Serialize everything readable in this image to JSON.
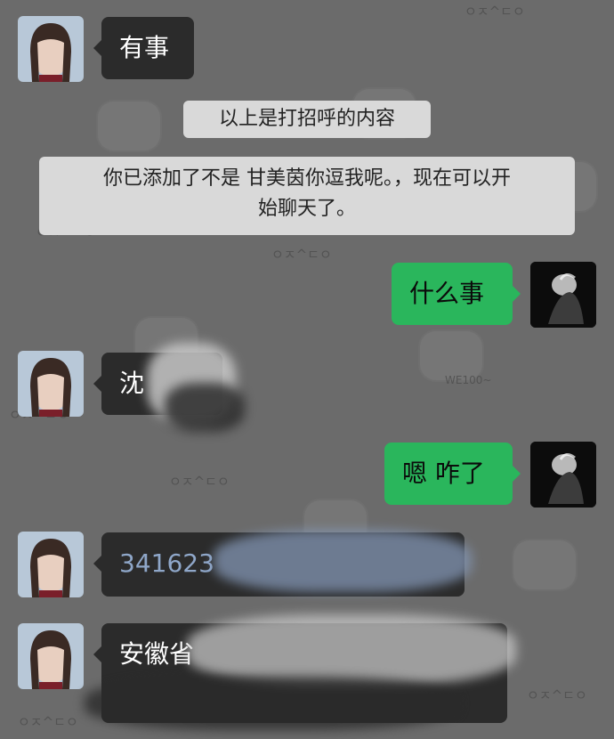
{
  "watermark_text": "ㅇㅈ^ㄷㅇ",
  "watermark_small": "WE100~",
  "messages": {
    "m1": "有事",
    "sys1": "以上是打招呼的内容",
    "sys2_line1": "你已添加了不是 甘美茵你逗我呢。，现在可以开",
    "sys2_line2": "始聊天了。",
    "m2": "什么事",
    "m3": "沈",
    "m4": "嗯 咋了",
    "m5": "341623",
    "m6": "安徽省"
  },
  "colors": {
    "background": "#6b6b6b",
    "incoming_bubble": "#2b2b2b",
    "outgoing_bubble": "#2ab65c",
    "system_notice": "#d9d9d9",
    "number_text": "#8fa7c9"
  }
}
